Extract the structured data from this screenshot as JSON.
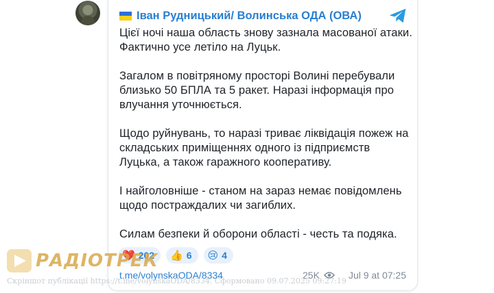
{
  "post": {
    "author": "Іван Рудницький/ Волинська ОДА (ОВА)",
    "paragraphs": [
      [
        "Цієї ночі наша область знову зазнала масованої атаки.",
        "Фактично усе летіло на Луцьк."
      ],
      [
        "Загалом в повітряному просторі Волині перебували",
        "близько 50 БПЛА та 5 ракет. Наразі інформація про",
        "влучання уточнюється."
      ],
      [
        "Щодо руйнувань, то наразі триває ліквідація пожеж на",
        "складських приміщеннях одного із підприємств",
        "Луцька, а також гаражного кооперативу."
      ],
      [
        "І найголовніше - станом на зараз немає повідомлень",
        "щодо постраждалих чи загиблих."
      ],
      [
        "Силам безпеки й оборони області - честь та подяка."
      ]
    ],
    "reactions": [
      {
        "emoji": "❤️",
        "count": "202"
      },
      {
        "emoji": "👍",
        "count": "6"
      },
      {
        "emoji": "😢",
        "count": "4"
      }
    ],
    "link": "t.me/volynskaODA/8334",
    "views": "25K",
    "time": "Jul 9 at 07:25"
  },
  "watermark": {
    "brand": "РАДІОТРЕК",
    "caption": "Скріншот публікації https://t.me/volynskaODA/8334. Сформовано 09.07.2025 09:27:19"
  },
  "colors": {
    "accent": "#2a7fd0",
    "flag_blue": "#2b6fd6",
    "flag_yellow": "#f7d018"
  },
  "icons": {
    "channel": "telegram-icon",
    "views": "eye-icon"
  }
}
